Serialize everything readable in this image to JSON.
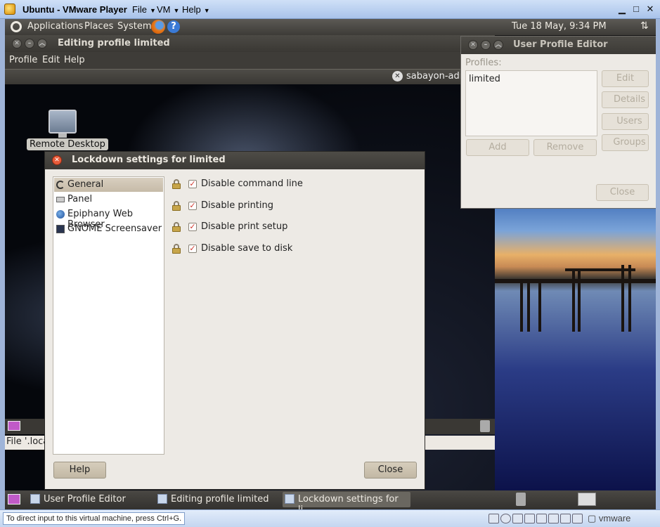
{
  "vmware": {
    "title": "Ubuntu - VMware Player",
    "menus": [
      "File",
      "VM",
      "Help"
    ],
    "hint": "To direct input to this virtual machine, press Ctrl+G.",
    "brand_prefix": "",
    "brand": "vmware"
  },
  "guest_panel": {
    "menus": [
      "Applications",
      "Places",
      "System"
    ],
    "clock": "Tue 18 May,  9:34 PM"
  },
  "edit_window": {
    "title": "Editing profile limited",
    "menus": [
      "Profile",
      "Edit",
      "Help"
    ],
    "inner_user": "sabayon-adm",
    "status_text": "File '.loca"
  },
  "desktop": {
    "icon_label": "Remote Desktop"
  },
  "lockdown": {
    "title": "Lockdown settings for limited",
    "categories": [
      "General",
      "Panel",
      "Epiphany Web Browser",
      "GNOME Screensaver"
    ],
    "options": [
      "Disable command line",
      "Disable printing",
      "Disable print setup",
      "Disable save to disk"
    ],
    "help_label": "Help",
    "close_label": "Close"
  },
  "upe": {
    "title": "User Profile Editor",
    "profiles_label": "Profiles:",
    "profiles": [
      "limited"
    ],
    "buttons": {
      "edit": "Edit",
      "details": "Details",
      "users": "Users",
      "groups": "Groups",
      "add": "Add",
      "remove": "Remove",
      "close": "Close"
    }
  },
  "taskbar": [
    "User Profile Editor",
    "Editing profile limited",
    "Lockdown settings for li..."
  ]
}
